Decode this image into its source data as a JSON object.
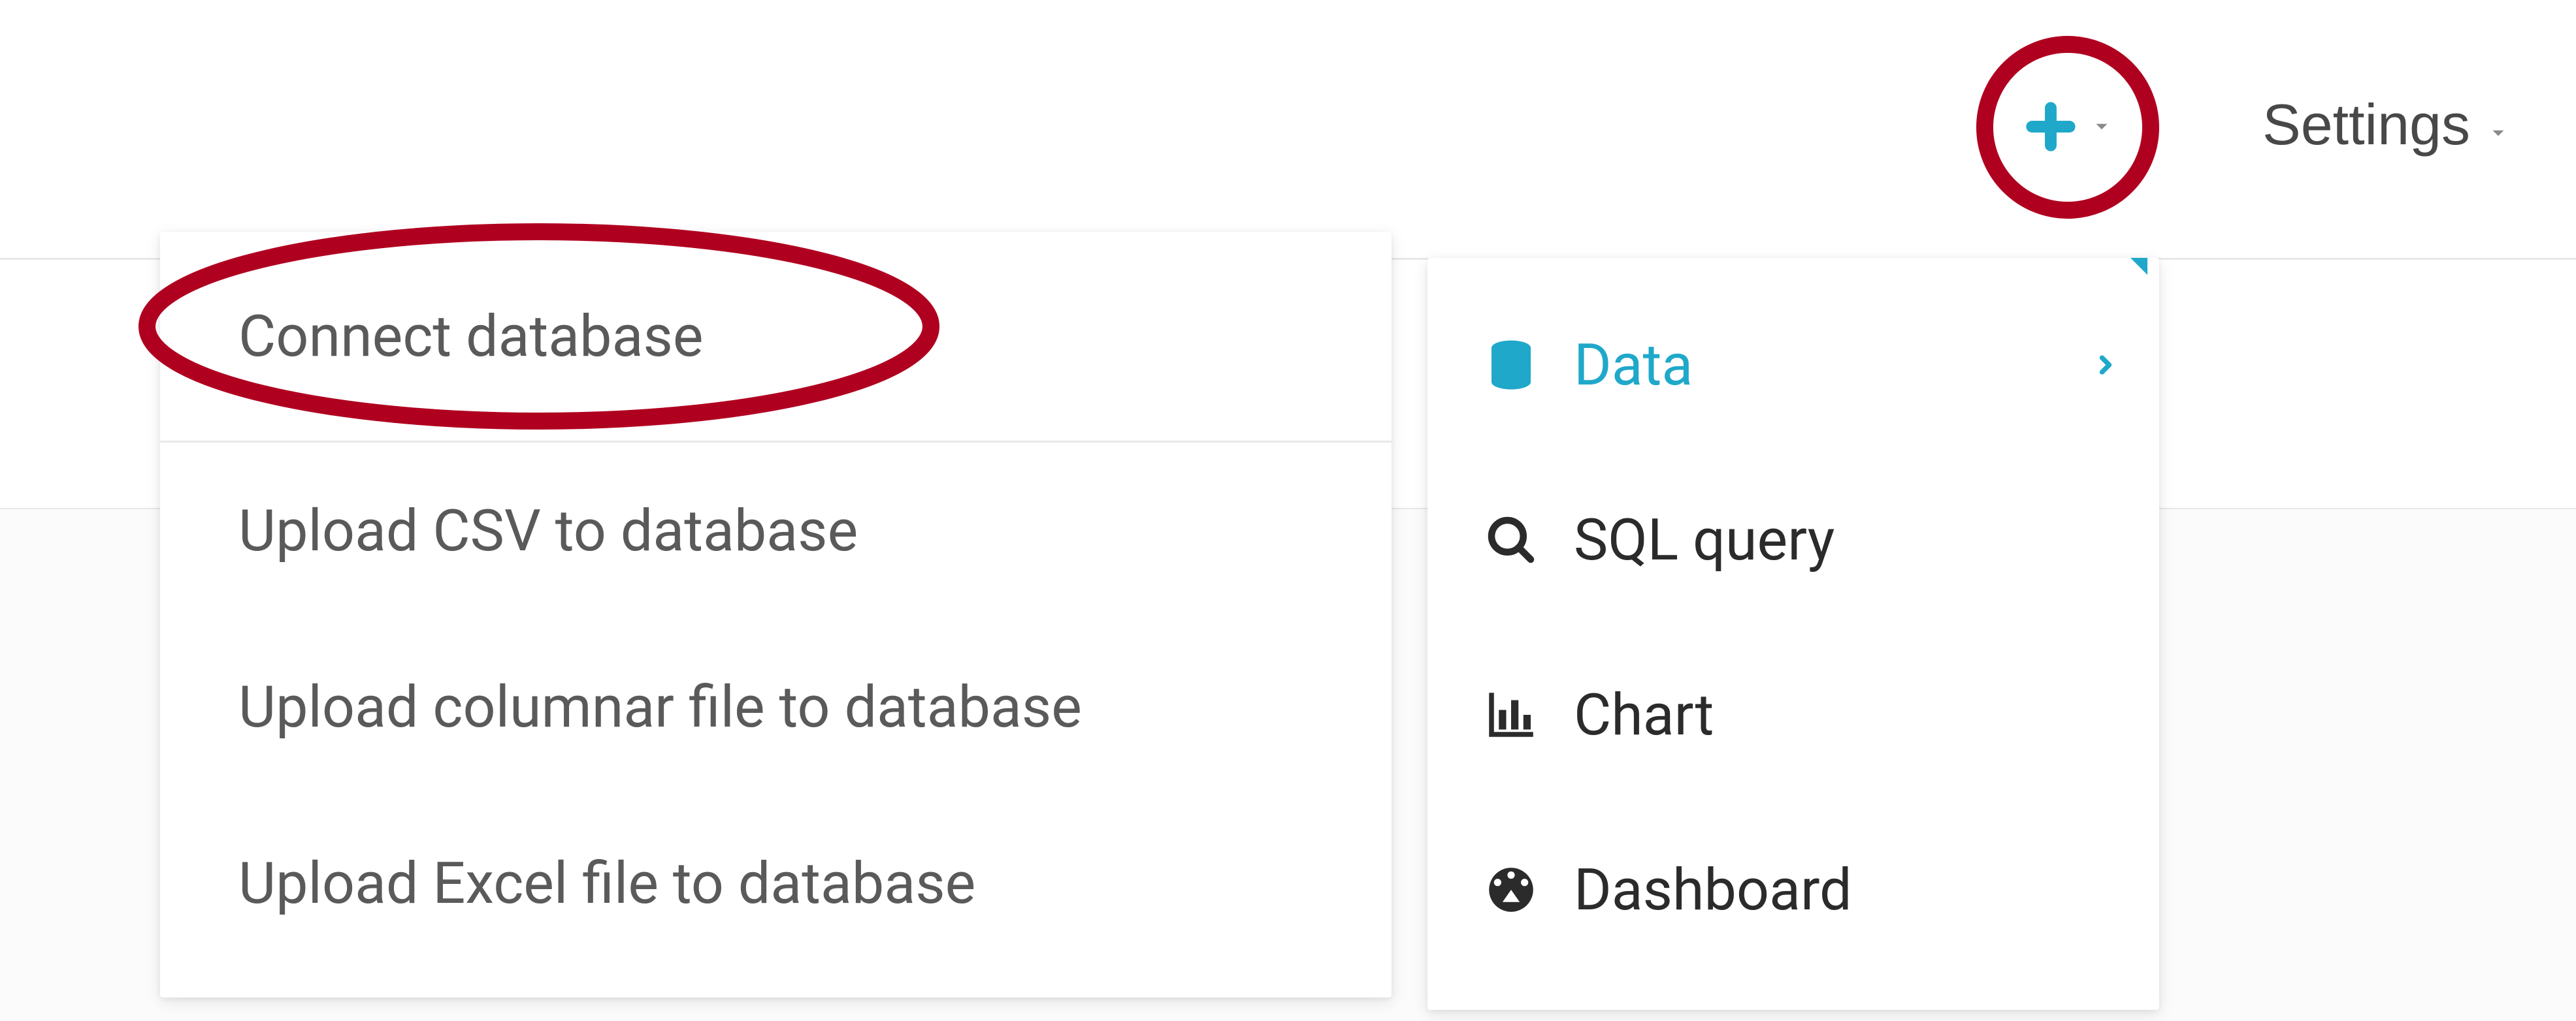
{
  "topbar": {
    "settings_label": "Settings"
  },
  "primary_menu": {
    "items": [
      {
        "label": "Data",
        "icon": "database",
        "active": true,
        "has_submenu": true
      },
      {
        "label": "SQL query",
        "icon": "search",
        "active": false,
        "has_submenu": false
      },
      {
        "label": "Chart",
        "icon": "chart",
        "active": false,
        "has_submenu": false
      },
      {
        "label": "Dashboard",
        "icon": "dashboard",
        "active": false,
        "has_submenu": false
      }
    ]
  },
  "submenu": {
    "items": [
      {
        "label": "Connect database",
        "highlighted": true
      },
      {
        "label": "Upload CSV to database",
        "highlighted": false
      },
      {
        "label": "Upload columnar file to database",
        "highlighted": false
      },
      {
        "label": "Upload Excel file to database",
        "highlighted": false
      }
    ]
  },
  "accent_color": "#1fa8c9",
  "highlight_color": "#b00020"
}
